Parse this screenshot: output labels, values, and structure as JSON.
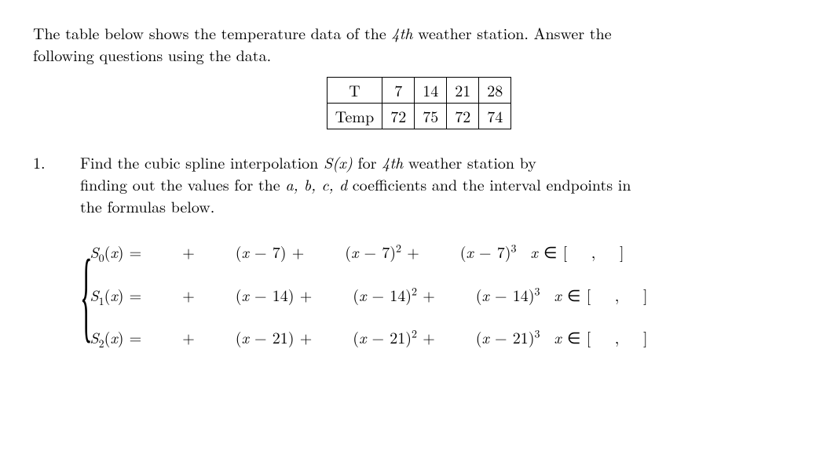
{
  "intro": {
    "line1_a": "The table below shows the temperature data of the ",
    "ordinal": "4th",
    "line1_b": " weather station. Answer the",
    "line2": "following questions using the data."
  },
  "table": {
    "row1": [
      "T",
      "7",
      "14",
      "21",
      "28"
    ],
    "row2": [
      "Temp",
      "72",
      "75",
      "72",
      "74"
    ]
  },
  "question": {
    "number": "1.",
    "lead_a": "Find the cubic spline interpolation ",
    "lead_fn": "S(x)",
    "lead_b": " for ",
    "ordinal": "4th",
    "lead_c": " weather station by",
    "line2_a": "finding out the values for the ",
    "coeffs": "a, b, c, d",
    "line2_b": " coefficients and the interval endpoints in",
    "line3": "the formulas below."
  },
  "chart_data": {
    "type": "table",
    "title": "Temperature data of 4th weather station",
    "columns": [
      "T",
      "Temp"
    ],
    "rows": [
      {
        "T": 7,
        "Temp": 72
      },
      {
        "T": 14,
        "Temp": 75
      },
      {
        "T": 21,
        "Temp": 72
      },
      {
        "T": 28,
        "Temp": 74
      }
    ]
  },
  "spline": {
    "pieces": [
      {
        "name": "S",
        "sub": "0",
        "arg": "x",
        "node": "7"
      },
      {
        "name": "S",
        "sub": "1",
        "arg": "x",
        "node": "14"
      },
      {
        "name": "S",
        "sub": "2",
        "arg": "x",
        "node": "21"
      }
    ]
  },
  "sym": {
    "eq": "=",
    "plus": "+",
    "minus": "−",
    "lpar": "(",
    "rpar": ")",
    "x": "x",
    "in": "∈",
    "lbr": "[",
    "rbr": "]",
    "comma": ","
  }
}
